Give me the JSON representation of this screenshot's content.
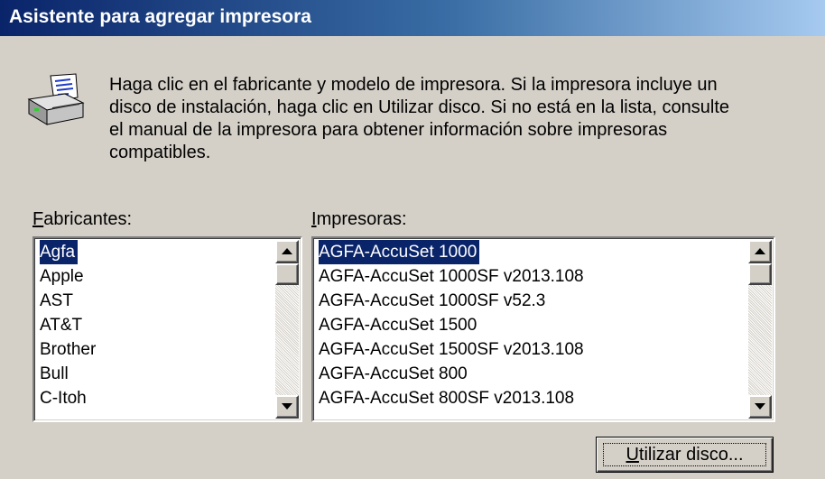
{
  "window": {
    "title": "Asistente para agregar impresora",
    "colors": {
      "titlebar_start": "#0a246a",
      "titlebar_end": "#a6caf0",
      "face": "#d4d0c8",
      "selection": "#0a246a"
    }
  },
  "intro": {
    "icon": "printer-icon",
    "lines": [
      "Haga clic en el fabricante y modelo de impresora. Si la impresora incluye un",
      "disco de instalación, haga clic en Utilizar disco. Si no está en la lista, consulte",
      "el manual de la impresora para obtener información sobre impresoras",
      "compatibles."
    ]
  },
  "manufacturers": {
    "label_mnemonic": "F",
    "label_rest": "abricantes:",
    "selected": "Agfa",
    "items": [
      "Agfa",
      "Apple",
      "AST",
      "AT&T",
      "Brother",
      "Bull",
      "C-Itoh"
    ]
  },
  "printers": {
    "label_mnemonic": "I",
    "label_rest": "mpresoras:",
    "selected": "AGFA-AccuSet 1000",
    "items": [
      "AGFA-AccuSet 1000",
      "AGFA-AccuSet 1000SF v2013.108",
      "AGFA-AccuSet 1000SF v52.3",
      "AGFA-AccuSet 1500",
      "AGFA-AccuSet 1500SF v2013.108",
      "AGFA-AccuSet 800",
      "AGFA-AccuSet 800SF v2013.108"
    ]
  },
  "buttons": {
    "have_disk_mnemonic": "U",
    "have_disk_rest": "tilizar disco..."
  }
}
